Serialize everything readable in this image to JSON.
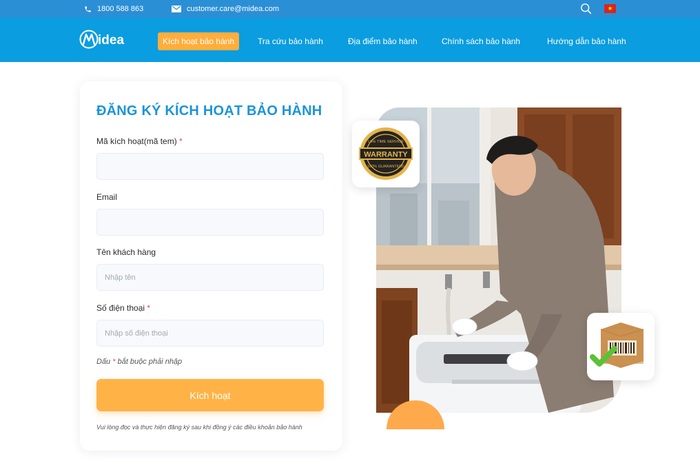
{
  "topbar": {
    "phone": "1800 588 863",
    "email": "customer.care@midea.com",
    "search_icon": "search-icon",
    "flag": "vietnam-flag-icon"
  },
  "brand": {
    "logo_text": "Midea"
  },
  "nav": {
    "items": [
      {
        "label": "Kích hoạt bảo hành",
        "active": true
      },
      {
        "label": "Tra cứu bảo hành"
      },
      {
        "label": "Địa điểm bảo hành"
      },
      {
        "label": "Chính sách bảo hành"
      },
      {
        "label": "Hướng dẫn bảo hành"
      }
    ]
  },
  "form": {
    "title": "ĐĂNG KÝ KÍCH HOẠT BẢO HÀNH",
    "fields": [
      {
        "label": "Mã kích hoạt(mã tem)",
        "required": true,
        "placeholder": "",
        "value": ""
      },
      {
        "label": "Email",
        "required": false,
        "placeholder": "",
        "value": ""
      },
      {
        "label": "Tên khách hàng",
        "required": false,
        "placeholder": "Nhập tên",
        "value": ""
      },
      {
        "label": "Số điện thoại",
        "required": true,
        "placeholder": "Nhập số điện thoại",
        "value": ""
      }
    ],
    "required_note_prefix": "Dấu ",
    "required_note_star": "*",
    "required_note_suffix": " bắt buộc phải nhập",
    "submit_label": "Kích hoạt",
    "terms": "Vui lòng đọc và thực hiện đăng ký sau khi đồng ý các điều khoản bảo hành"
  },
  "illustration": {
    "warranty_badge": {
      "main": "WARRANTY",
      "top": "LIFE TIME SERVICE",
      "bottom": "100% GUARANTEED"
    },
    "icons": [
      "warranty-seal-icon",
      "package-check-icon"
    ]
  },
  "colors": {
    "topbar": "#2b8fd6",
    "navbar": "#0a9de0",
    "accent_orange": "#ffb347",
    "title_blue": "#1a94dc",
    "required_red": "#e24b4b"
  }
}
